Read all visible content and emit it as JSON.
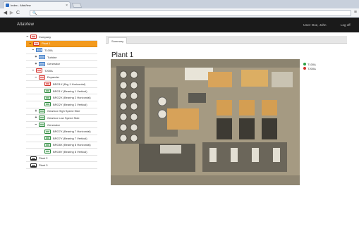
{
  "browser": {
    "tab_title": "Index - AltaView",
    "tab_close": "×",
    "url": "",
    "back": "◀",
    "forward": "▶",
    "reload": "C",
    "url_icon": "🔍",
    "menu": "≡"
  },
  "header": {
    "brand": "AltaView",
    "user": "User: Doe, John",
    "logoff": "Log off"
  },
  "tree": {
    "items": [
      {
        "label": "Company",
        "toggle": "−",
        "icon": "company-icon",
        "color": "red"
      },
      {
        "label": "Plant 1",
        "toggle": "−",
        "icon": "plant-icon",
        "color": "red",
        "selected": true
      },
      {
        "label": "T100A",
        "toggle": "−",
        "icon": "train-icon",
        "color": "blue"
      },
      {
        "label": "Turbine",
        "toggle": "+",
        "icon": "turbine-icon",
        "color": "blue"
      },
      {
        "label": "Generator",
        "toggle": "+",
        "icon": "generator-icon",
        "color": "blue"
      },
      {
        "label": "T200A",
        "toggle": "−",
        "icon": "train-icon",
        "color": "red"
      },
      {
        "label": "Expander",
        "toggle": "−",
        "icon": "expander-icon",
        "color": "red"
      },
      {
        "label": "BRG1X (Brg 1 Horizontal)",
        "toggle": "",
        "icon": "sensor-icon",
        "color": "red"
      },
      {
        "label": "BRG1Y (Bearing 1 Vertical)",
        "toggle": "",
        "icon": "sensor-icon",
        "color": "green"
      },
      {
        "label": "BRG2X (Bearing 2 Horizontal)",
        "toggle": "",
        "icon": "sensor-icon",
        "color": "green"
      },
      {
        "label": "BRG2Y (Bearing 2 Vertical)",
        "toggle": "",
        "icon": "sensor-icon",
        "color": "green"
      },
      {
        "label": "Gearbox High Speed Side",
        "toggle": "+",
        "icon": "gearbox-icon",
        "color": "green"
      },
      {
        "label": "Gearbox Low Speed Side",
        "toggle": "+",
        "icon": "gearbox-icon",
        "color": "green"
      },
      {
        "label": "Generator",
        "toggle": "−",
        "icon": "generator-icon",
        "color": "green"
      },
      {
        "label": "BRG7X (Bearing 7 Horizontal)",
        "toggle": "",
        "icon": "sensor-icon",
        "color": "green"
      },
      {
        "label": "BRG7Y (Bearing 7 Vertical)",
        "toggle": "",
        "icon": "sensor-icon",
        "color": "green"
      },
      {
        "label": "BRG8X (Bearing 8 Horizontal)",
        "toggle": "",
        "icon": "sensor-icon",
        "color": "green"
      },
      {
        "label": "BRG8Y (Bearing 8 Vertical)",
        "toggle": "",
        "icon": "sensor-icon",
        "color": "green"
      },
      {
        "label": "Plant 2",
        "toggle": "",
        "icon": "plant-icon",
        "color": "plant"
      },
      {
        "label": "Plant 3",
        "toggle": "",
        "icon": "plant-icon",
        "color": "plant"
      }
    ]
  },
  "main": {
    "tab": "Summary",
    "title": "Plant 1",
    "legend": [
      {
        "label": "T100A",
        "color": "#2ea043"
      },
      {
        "label": "T200A",
        "color": "#d3312b"
      }
    ],
    "image_alt": "aerial-plant-photo"
  },
  "colors": {
    "selected": "#f39a1e",
    "header_bg": "#1a1a1a"
  }
}
